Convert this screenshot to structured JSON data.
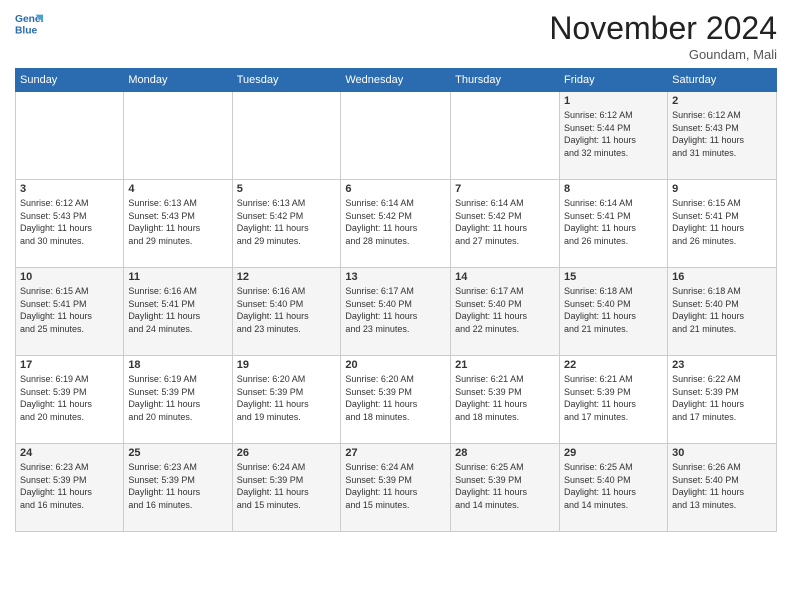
{
  "logo": {
    "line1": "General",
    "line2": "Blue"
  },
  "title": "November 2024",
  "location": "Goundam, Mali",
  "days_header": [
    "Sunday",
    "Monday",
    "Tuesday",
    "Wednesday",
    "Thursday",
    "Friday",
    "Saturday"
  ],
  "weeks": [
    [
      {
        "day": "",
        "info": ""
      },
      {
        "day": "",
        "info": ""
      },
      {
        "day": "",
        "info": ""
      },
      {
        "day": "",
        "info": ""
      },
      {
        "day": "",
        "info": ""
      },
      {
        "day": "1",
        "info": "Sunrise: 6:12 AM\nSunset: 5:44 PM\nDaylight: 11 hours\nand 32 minutes."
      },
      {
        "day": "2",
        "info": "Sunrise: 6:12 AM\nSunset: 5:43 PM\nDaylight: 11 hours\nand 31 minutes."
      }
    ],
    [
      {
        "day": "3",
        "info": "Sunrise: 6:12 AM\nSunset: 5:43 PM\nDaylight: 11 hours\nand 30 minutes."
      },
      {
        "day": "4",
        "info": "Sunrise: 6:13 AM\nSunset: 5:43 PM\nDaylight: 11 hours\nand 29 minutes."
      },
      {
        "day": "5",
        "info": "Sunrise: 6:13 AM\nSunset: 5:42 PM\nDaylight: 11 hours\nand 29 minutes."
      },
      {
        "day": "6",
        "info": "Sunrise: 6:14 AM\nSunset: 5:42 PM\nDaylight: 11 hours\nand 28 minutes."
      },
      {
        "day": "7",
        "info": "Sunrise: 6:14 AM\nSunset: 5:42 PM\nDaylight: 11 hours\nand 27 minutes."
      },
      {
        "day": "8",
        "info": "Sunrise: 6:14 AM\nSunset: 5:41 PM\nDaylight: 11 hours\nand 26 minutes."
      },
      {
        "day": "9",
        "info": "Sunrise: 6:15 AM\nSunset: 5:41 PM\nDaylight: 11 hours\nand 26 minutes."
      }
    ],
    [
      {
        "day": "10",
        "info": "Sunrise: 6:15 AM\nSunset: 5:41 PM\nDaylight: 11 hours\nand 25 minutes."
      },
      {
        "day": "11",
        "info": "Sunrise: 6:16 AM\nSunset: 5:41 PM\nDaylight: 11 hours\nand 24 minutes."
      },
      {
        "day": "12",
        "info": "Sunrise: 6:16 AM\nSunset: 5:40 PM\nDaylight: 11 hours\nand 23 minutes."
      },
      {
        "day": "13",
        "info": "Sunrise: 6:17 AM\nSunset: 5:40 PM\nDaylight: 11 hours\nand 23 minutes."
      },
      {
        "day": "14",
        "info": "Sunrise: 6:17 AM\nSunset: 5:40 PM\nDaylight: 11 hours\nand 22 minutes."
      },
      {
        "day": "15",
        "info": "Sunrise: 6:18 AM\nSunset: 5:40 PM\nDaylight: 11 hours\nand 21 minutes."
      },
      {
        "day": "16",
        "info": "Sunrise: 6:18 AM\nSunset: 5:40 PM\nDaylight: 11 hours\nand 21 minutes."
      }
    ],
    [
      {
        "day": "17",
        "info": "Sunrise: 6:19 AM\nSunset: 5:39 PM\nDaylight: 11 hours\nand 20 minutes."
      },
      {
        "day": "18",
        "info": "Sunrise: 6:19 AM\nSunset: 5:39 PM\nDaylight: 11 hours\nand 20 minutes."
      },
      {
        "day": "19",
        "info": "Sunrise: 6:20 AM\nSunset: 5:39 PM\nDaylight: 11 hours\nand 19 minutes."
      },
      {
        "day": "20",
        "info": "Sunrise: 6:20 AM\nSunset: 5:39 PM\nDaylight: 11 hours\nand 18 minutes."
      },
      {
        "day": "21",
        "info": "Sunrise: 6:21 AM\nSunset: 5:39 PM\nDaylight: 11 hours\nand 18 minutes."
      },
      {
        "day": "22",
        "info": "Sunrise: 6:21 AM\nSunset: 5:39 PM\nDaylight: 11 hours\nand 17 minutes."
      },
      {
        "day": "23",
        "info": "Sunrise: 6:22 AM\nSunset: 5:39 PM\nDaylight: 11 hours\nand 17 minutes."
      }
    ],
    [
      {
        "day": "24",
        "info": "Sunrise: 6:23 AM\nSunset: 5:39 PM\nDaylight: 11 hours\nand 16 minutes."
      },
      {
        "day": "25",
        "info": "Sunrise: 6:23 AM\nSunset: 5:39 PM\nDaylight: 11 hours\nand 16 minutes."
      },
      {
        "day": "26",
        "info": "Sunrise: 6:24 AM\nSunset: 5:39 PM\nDaylight: 11 hours\nand 15 minutes."
      },
      {
        "day": "27",
        "info": "Sunrise: 6:24 AM\nSunset: 5:39 PM\nDaylight: 11 hours\nand 15 minutes."
      },
      {
        "day": "28",
        "info": "Sunrise: 6:25 AM\nSunset: 5:39 PM\nDaylight: 11 hours\nand 14 minutes."
      },
      {
        "day": "29",
        "info": "Sunrise: 6:25 AM\nSunset: 5:40 PM\nDaylight: 11 hours\nand 14 minutes."
      },
      {
        "day": "30",
        "info": "Sunrise: 6:26 AM\nSunset: 5:40 PM\nDaylight: 11 hours\nand 13 minutes."
      }
    ]
  ]
}
